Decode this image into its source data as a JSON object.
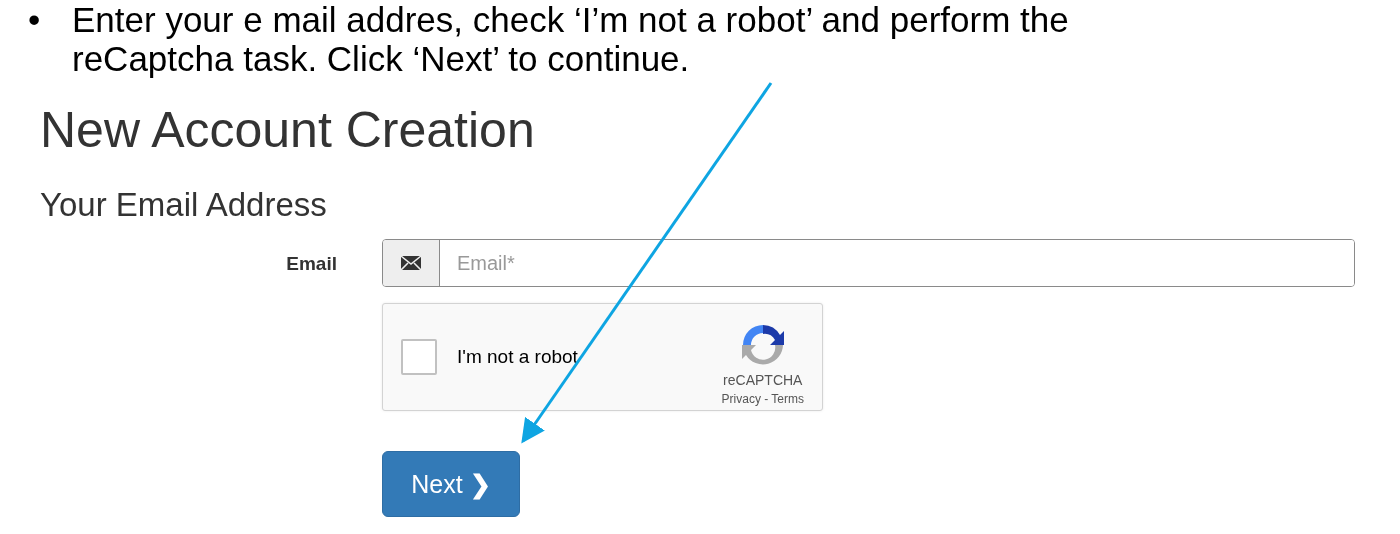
{
  "instruction": {
    "bullet": "•",
    "text": "Enter your e mail addres, check ‘I’m not a robot’ and perform the reCaptcha task. Click ‘Next’ to continue."
  },
  "page": {
    "title": "New Account Creation",
    "section": "Your Email Address"
  },
  "email": {
    "label": "Email",
    "placeholder": "Email*"
  },
  "captcha": {
    "label": "I'm not a robot",
    "checked": false,
    "brand": "reCAPTCHA",
    "links": "Privacy - Terms"
  },
  "next_button": {
    "label": "Next",
    "icon": "❯"
  }
}
